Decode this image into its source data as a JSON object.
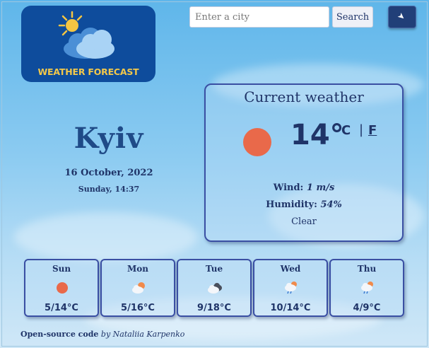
{
  "logo": {
    "text": "WEATHER FORECAST",
    "icon": "sun-behind-cloud-icon"
  },
  "search": {
    "placeholder": "Enter a city",
    "button_label": "Search",
    "location_icon": "location-arrow-icon"
  },
  "city": {
    "name": "Kyiv",
    "date": "16 October, 2022",
    "day_time": "Sunday, 14:37"
  },
  "current": {
    "title": "Current weather",
    "icon": "sun-icon",
    "temperature": "14°",
    "unit_c": "C",
    "unit_separator": "|",
    "unit_f": "F",
    "wind_label": "Wind:",
    "wind_value": "1 m/s",
    "humidity_label": "Humidity:",
    "humidity_value": "54%",
    "condition": "Clear"
  },
  "forecast": [
    {
      "day": "Sun",
      "temp": "5/14°C",
      "icon": "sun-icon"
    },
    {
      "day": "Mon",
      "temp": "5/16°C",
      "icon": "partly-cloudy-icon"
    },
    {
      "day": "Tue",
      "temp": "9/18°C",
      "icon": "cloudy-icon"
    },
    {
      "day": "Wed",
      "temp": "10/14°C",
      "icon": "rain-icon"
    },
    {
      "day": "Thu",
      "temp": "4/9°C",
      "icon": "rain-icon"
    }
  ],
  "footer": {
    "link_text": "Open-source code",
    "author_text": "by Nataliia Karpenko"
  },
  "colors": {
    "accent": "#1f3468",
    "sun": "#e9694a",
    "logo_bg": "#0e4c9c",
    "logo_text": "#f3c84a"
  }
}
